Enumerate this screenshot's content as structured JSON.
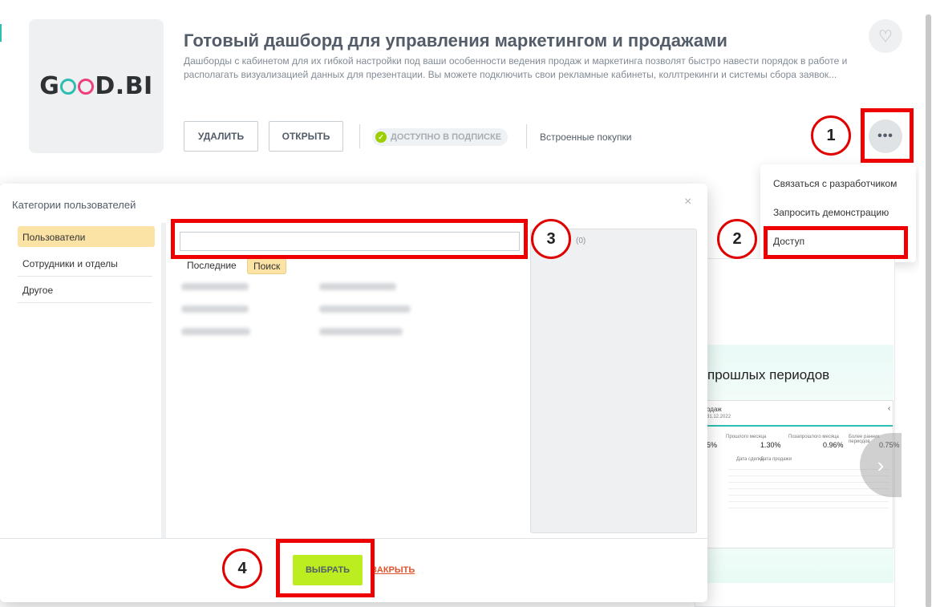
{
  "app": {
    "logo_text_left": "G",
    "logo_text_right": "D.BI",
    "title": "Готовый дашборд для управления маркетингом и продажами",
    "description": "Дашборды с кабинетом для их гибкой настройки под ваши особенности ведения продаж и маркетинга позволят быстро навести порядок в работе и располагать визуализацией данных для презентации. Вы можете подключить свои рекламные кабинеты, коллтрекинги и системы сбора заявок...",
    "delete_label": "УДАЛИТЬ",
    "open_label": "ОТКРЫТЬ",
    "subscription_badge": "ДОСТУПНО В ПОДПИСКЕ",
    "in_app_purchases": "Встроенные покупки",
    "more_icon": "•••"
  },
  "menu": {
    "items": [
      "Связаться с разработчиком",
      "Запросить демонстрацию",
      "Доступ"
    ]
  },
  "preview": {
    "heading": "прошлых периодов",
    "shot_title": "одаж",
    "shot_date": "31.12.2022",
    "metrics": [
      {
        "label": "Прошлого месяца",
        "value": "1.30%"
      },
      {
        "label": "Позапрошлого месяца",
        "value": "0.96%"
      },
      {
        "label": "Более ранних периодов",
        "value": "0.75%"
      }
    ],
    "left_value": "5%",
    "col_a": "Дата сделки",
    "col_b": "Дата продажи",
    "next_icon": "›"
  },
  "dialog": {
    "title": "Категории пользователей",
    "close_icon": "×",
    "categories": [
      "Пользователи",
      "Сотрудники и отделы",
      "Другое"
    ],
    "search_value": "",
    "tabs": [
      "Последние",
      "Поиск"
    ],
    "selected_count": "(0)",
    "choose_label": "ВЫБРАТЬ",
    "close_label": "ЗАКРЫТЬ"
  },
  "annotations": [
    "1",
    "2",
    "3",
    "4"
  ],
  "colors": {
    "accent_green": "#bbed21",
    "annotation_red": "#ee0000",
    "active_tab": "#fbe3a6",
    "link_red": "#e0532c"
  }
}
